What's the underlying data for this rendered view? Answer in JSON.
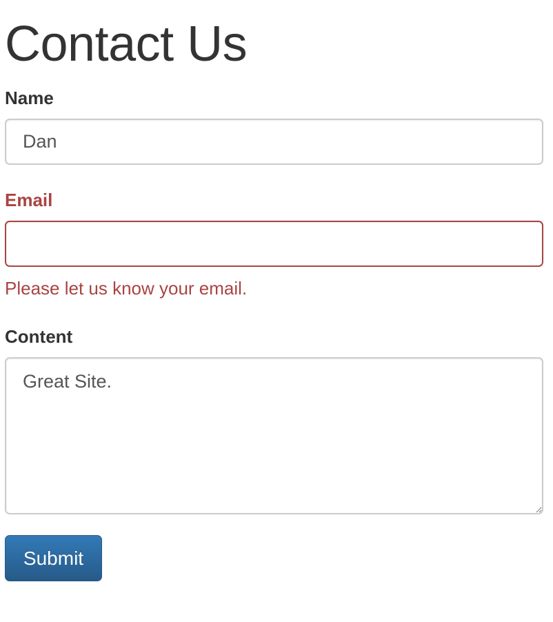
{
  "form": {
    "title": "Contact Us",
    "name": {
      "label": "Name",
      "value": "Dan"
    },
    "email": {
      "label": "Email",
      "value": "",
      "error_message": "Please let us know your email.",
      "error_color": "#a94442"
    },
    "content": {
      "label": "Content",
      "value": "Great Site."
    },
    "submit_label": "Submit",
    "submit_color": "#337ab7"
  }
}
